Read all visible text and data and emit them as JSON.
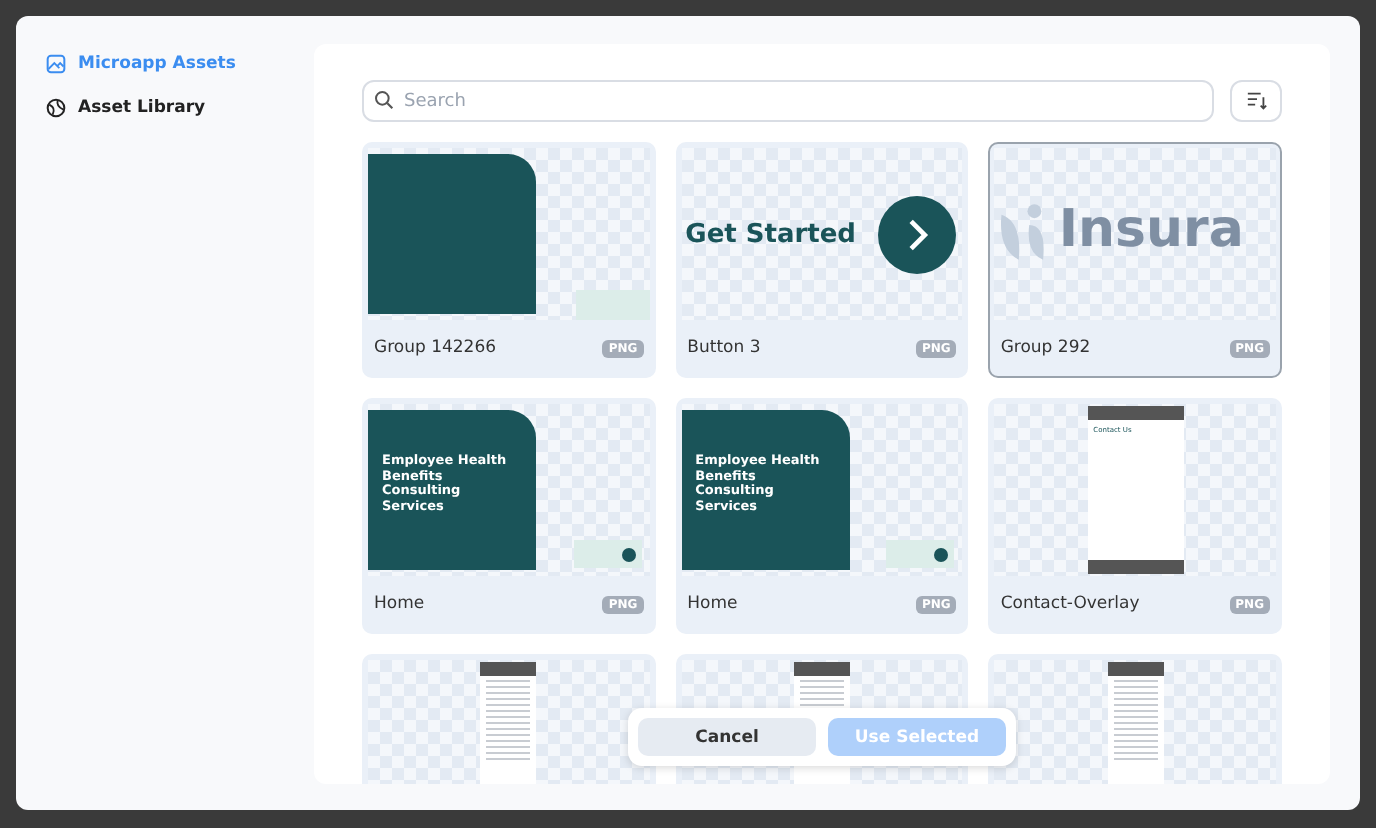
{
  "sidebar": {
    "items": [
      {
        "label": "Microapp Assets",
        "selected": true,
        "kind": "image"
      },
      {
        "label": "Asset Library",
        "selected": false,
        "kind": "library"
      }
    ]
  },
  "search": {
    "placeholder": "Search"
  },
  "assets": [
    {
      "name": "Group 142266",
      "badge": "PNG",
      "selected": false,
      "kind": "block"
    },
    {
      "name": "Button 3",
      "badge": "PNG",
      "selected": false,
      "kind": "button",
      "text": "Get Started"
    },
    {
      "name": "Group 292",
      "badge": "PNG",
      "selected": true,
      "kind": "logo",
      "text": "Insura"
    },
    {
      "name": "Home",
      "badge": "PNG",
      "selected": false,
      "kind": "home",
      "text": "Employee Health Benefits Consulting Services"
    },
    {
      "name": "Home",
      "badge": "PNG",
      "selected": false,
      "kind": "home",
      "text": "Employee Health Benefits Consulting Services"
    },
    {
      "name": "Contact-Overlay",
      "badge": "PNG",
      "selected": false,
      "kind": "overlay",
      "text": "Contact Us"
    },
    {
      "selected": false,
      "kind": "doc"
    },
    {
      "selected": false,
      "kind": "doc"
    },
    {
      "selected": false,
      "kind": "doc"
    }
  ],
  "buttons": [
    {
      "label": "Cancel",
      "disabled": false
    },
    {
      "label": "Use Selected",
      "disabled": true
    }
  ]
}
